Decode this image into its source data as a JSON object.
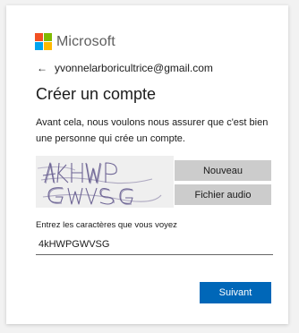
{
  "brand": {
    "name": "Microsoft",
    "logo_colors": [
      "#f25022",
      "#7fba00",
      "#00a4ef",
      "#ffb900"
    ]
  },
  "identity": {
    "back_icon": "arrow-left-icon",
    "email": "yvonnelarboricultrice@gmail.com"
  },
  "page": {
    "title": "Créer un compte",
    "description": "Avant cela, nous voulons nous assurer que c'est bien une personne qui crée un compte."
  },
  "captcha": {
    "image_icon": "captcha-image",
    "new_label": "Nouveau",
    "audio_label": "Fichier audio"
  },
  "form": {
    "label": "Entrez les caractères que vous voyez",
    "value": "4kHWPGWVSG"
  },
  "actions": {
    "next_label": "Suivant"
  },
  "colors": {
    "primary": "#0067b8",
    "secondary_button": "#cccccc",
    "captcha_ink": "#6d6494"
  }
}
